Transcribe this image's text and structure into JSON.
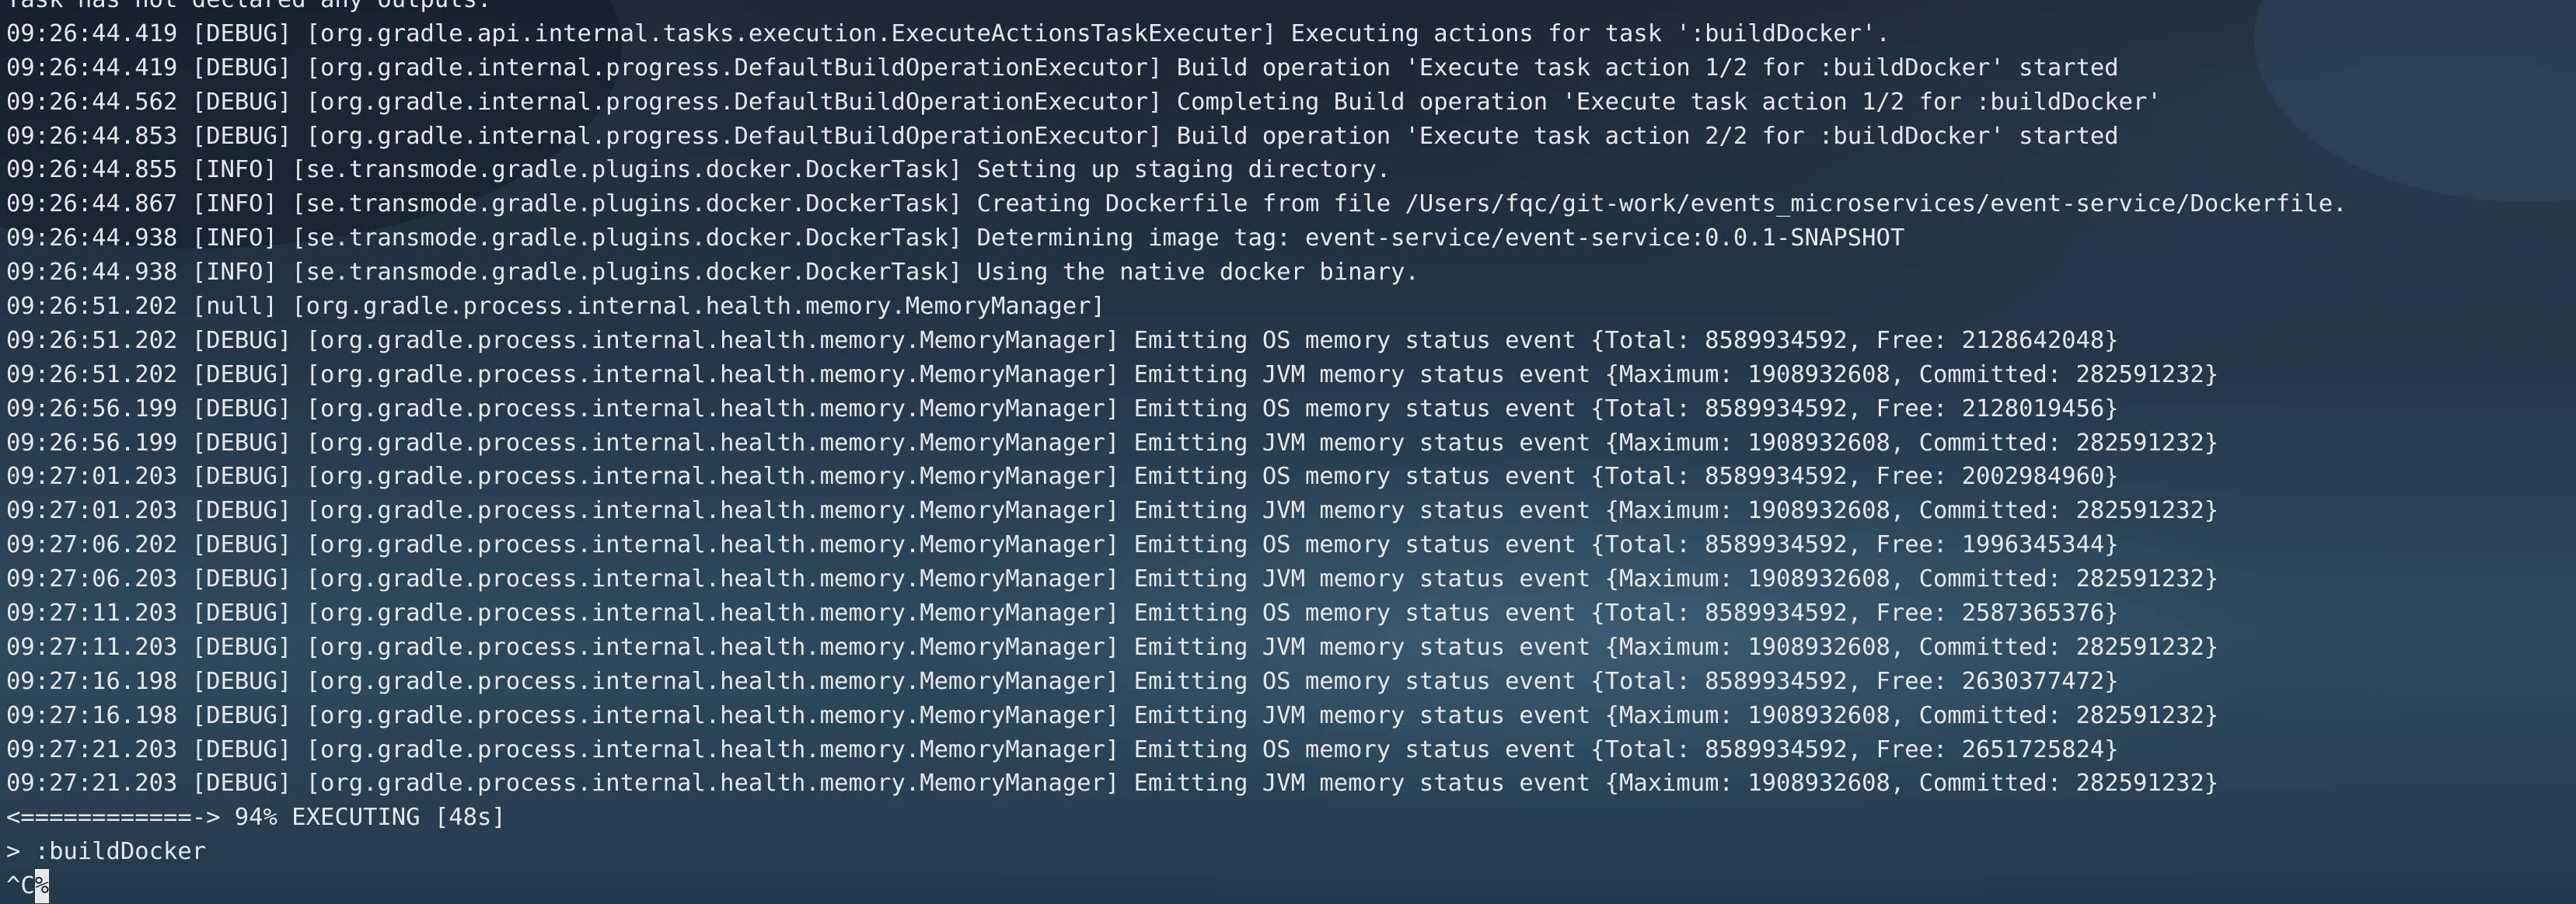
{
  "terminal": {
    "lines": [
      "Task has not declared any outputs.",
      "09:26:44.419 [DEBUG] [org.gradle.api.internal.tasks.execution.ExecuteActionsTaskExecuter] Executing actions for task ':buildDocker'.",
      "09:26:44.419 [DEBUG] [org.gradle.internal.progress.DefaultBuildOperationExecutor] Build operation 'Execute task action 1/2 for :buildDocker' started",
      "09:26:44.562 [DEBUG] [org.gradle.internal.progress.DefaultBuildOperationExecutor] Completing Build operation 'Execute task action 1/2 for :buildDocker'",
      "09:26:44.853 [DEBUG] [org.gradle.internal.progress.DefaultBuildOperationExecutor] Build operation 'Execute task action 2/2 for :buildDocker' started",
      "09:26:44.855 [INFO] [se.transmode.gradle.plugins.docker.DockerTask] Setting up staging directory.",
      "09:26:44.867 [INFO] [se.transmode.gradle.plugins.docker.DockerTask] Creating Dockerfile from file /Users/fqc/git-work/events_microservices/event-service/Dockerfile.",
      "09:26:44.938 [INFO] [se.transmode.gradle.plugins.docker.DockerTask] Determining image tag: event-service/event-service:0.0.1-SNAPSHOT",
      "09:26:44.938 [INFO] [se.transmode.gradle.plugins.docker.DockerTask] Using the native docker binary.",
      "09:26:51.202 [null] [org.gradle.process.internal.health.memory.MemoryManager]",
      "09:26:51.202 [DEBUG] [org.gradle.process.internal.health.memory.MemoryManager] Emitting OS memory status event {Total: 8589934592, Free: 2128642048}",
      "09:26:51.202 [DEBUG] [org.gradle.process.internal.health.memory.MemoryManager] Emitting JVM memory status event {Maximum: 1908932608, Committed: 282591232}",
      "09:26:56.199 [DEBUG] [org.gradle.process.internal.health.memory.MemoryManager] Emitting OS memory status event {Total: 8589934592, Free: 2128019456}",
      "09:26:56.199 [DEBUG] [org.gradle.process.internal.health.memory.MemoryManager] Emitting JVM memory status event {Maximum: 1908932608, Committed: 282591232}",
      "09:27:01.203 [DEBUG] [org.gradle.process.internal.health.memory.MemoryManager] Emitting OS memory status event {Total: 8589934592, Free: 2002984960}",
      "09:27:01.203 [DEBUG] [org.gradle.process.internal.health.memory.MemoryManager] Emitting JVM memory status event {Maximum: 1908932608, Committed: 282591232}",
      "09:27:06.202 [DEBUG] [org.gradle.process.internal.health.memory.MemoryManager] Emitting OS memory status event {Total: 8589934592, Free: 1996345344}",
      "09:27:06.203 [DEBUG] [org.gradle.process.internal.health.memory.MemoryManager] Emitting JVM memory status event {Maximum: 1908932608, Committed: 282591232}",
      "09:27:11.203 [DEBUG] [org.gradle.process.internal.health.memory.MemoryManager] Emitting OS memory status event {Total: 8589934592, Free: 2587365376}",
      "09:27:11.203 [DEBUG] [org.gradle.process.internal.health.memory.MemoryManager] Emitting JVM memory status event {Maximum: 1908932608, Committed: 282591232}",
      "09:27:16.198 [DEBUG] [org.gradle.process.internal.health.memory.MemoryManager] Emitting OS memory status event {Total: 8589934592, Free: 2630377472}",
      "09:27:16.198 [DEBUG] [org.gradle.process.internal.health.memory.MemoryManager] Emitting JVM memory status event {Maximum: 1908932608, Committed: 282591232}",
      "09:27:21.203 [DEBUG] [org.gradle.process.internal.health.memory.MemoryManager] Emitting OS memory status event {Total: 8589934592, Free: 2651725824}",
      "09:27:21.203 [DEBUG] [org.gradle.process.internal.health.memory.MemoryManager] Emitting JVM memory status event {Maximum: 1908932608, Committed: 282591232}"
    ],
    "progress_line": "<============-> 94% EXECUTING [48s]",
    "task_line": "> :buildDocker",
    "interrupt_prefix": "^C",
    "cursor_char": "%",
    "colors": {
      "text": "#e6e8ea",
      "background": "#182a38"
    }
  }
}
